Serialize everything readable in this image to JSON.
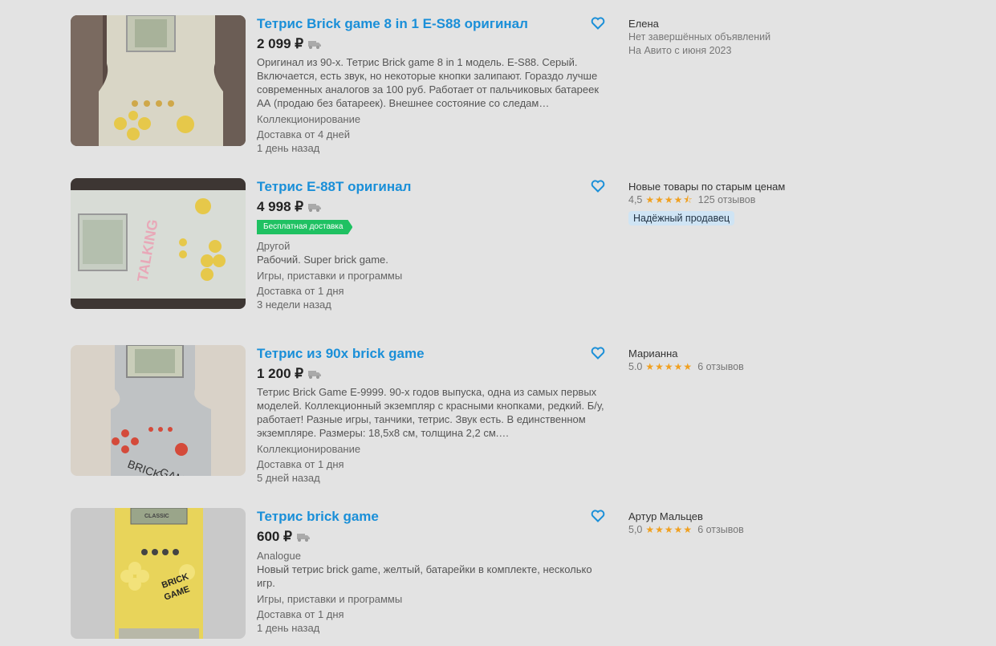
{
  "listings": [
    {
      "title": "Тетрис Brick game 8 in 1 E-S88 оригинал",
      "price": "2 099 ₽",
      "desc": "Оригинал из 90-х. Тетрис Brick game 8 in 1 модель. E-S88. Серый. Включается, есть звук, но некоторые кнопки залипают. Гораздо лучше современных аналогов за 100 руб. Работает от пальчиковых батареек АА (продаю без батареек). Внешнее состояние со следам…",
      "category": "Коллекционирование",
      "delivery": "Доставка от 4 дней",
      "time": "1 день назад",
      "seller": {
        "name": "Елена",
        "line1": "Нет завершённых объявлений",
        "line2": "На Авито с июня 2023"
      }
    },
    {
      "title": "Тетрис E-88T оригинал",
      "price": "4 998 ₽",
      "badge": "Бесплатная доставка",
      "condition": "Другой",
      "desc": "Рабочий. Super brick game.",
      "category": "Игры, приставки и программы",
      "delivery": "Доставка от 1 дня",
      "time": "3 недели назад",
      "seller": {
        "name": "Новые товары по старым ценам",
        "rating": "4,5",
        "stars": "★★★★⯪",
        "reviews": "125 отзывов",
        "badge": "Надёжный продавец"
      }
    },
    {
      "title": "Тетрис из 90х brick game",
      "price": "1 200 ₽",
      "desc": "Тетрис Brick Game E-9999. 90-х годов выпуска, одна из самых первых моделей. Коллекционный экземпляр с красными кнопками, редкий. Б/у, работает! Разные игры, танчики, тетрис. Звук есть. В единственном экземпляре. Размеры: 18,5х8 см, толщина 2,2 см.…",
      "category": "Коллекционирование",
      "delivery": "Доставка от 1 дня",
      "time": "5 дней назад",
      "seller": {
        "name": "Марианна",
        "rating": "5.0",
        "stars": "★★★★★",
        "reviews": "6 отзывов"
      }
    },
    {
      "title": "Тетрис brick game",
      "price": "600 ₽",
      "condition": "Analogue",
      "desc": "Новый тетрис brick game, желтый, батарейки в комплекте, несколько игр.",
      "category": "Игры, приставки и программы",
      "delivery": "Доставка от 1 дня",
      "time": "1 день назад",
      "seller": {
        "name": "Артур Мальцев",
        "rating": "5,0",
        "stars": "★★★★★",
        "reviews": "6 отзывов"
      }
    }
  ],
  "thumb_text": {
    "brick": "BRICK",
    "game": "GAME",
    "classic": "CLASSIC",
    "talking": "TALKING"
  },
  "colors": {
    "link": "#1a8fd8",
    "badge_green": "#1fc162",
    "star": "#f0a020",
    "reliable_bg": "#cfe4f4"
  },
  "icons": {
    "favorite": "heart-outline-icon",
    "delivery": "truck-icon"
  }
}
